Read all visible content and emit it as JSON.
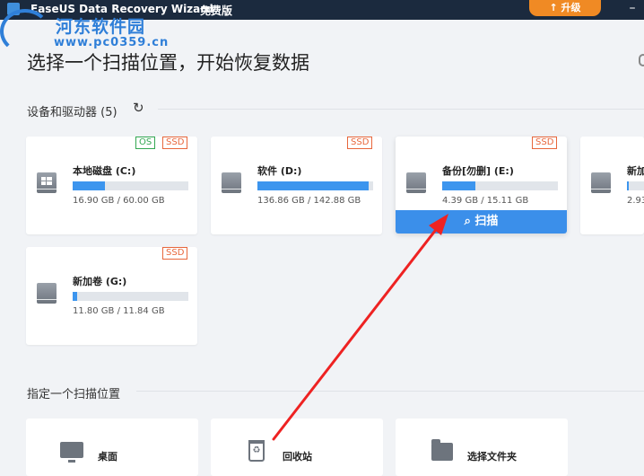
{
  "window": {
    "title": "EaseUS Data Recovery Wizard",
    "edition": "免费版",
    "upgrade_label": "升级",
    "minimize_symbol": "–"
  },
  "watermark": {
    "title": "河东软件园",
    "url": "www.pc0359.cn"
  },
  "page_title": "选择一个扫描位置，开始恢复数据",
  "devices_section": {
    "title": "设备和驱动器 (5)",
    "refresh_icon": "refresh-icon"
  },
  "drives": [
    {
      "name": "本地磁盘 (C:)",
      "used": "16.90 GB",
      "total": "60.00 GB",
      "size_text": "16.90 GB / 60.00 GB",
      "usage": 0.28,
      "badges": [
        "OS",
        "SSD"
      ],
      "icon": "windows-disk-icon"
    },
    {
      "name": "软件 (D:)",
      "used": "136.86 GB",
      "total": "142.88 GB",
      "size_text": "136.86 GB / 142.88 GB",
      "usage": 0.96,
      "badges": [
        "SSD"
      ],
      "icon": "disk-icon"
    },
    {
      "name": "备份[勿删] (E:)",
      "used": "4.39 GB",
      "total": "15.11 GB",
      "size_text": "4.39 GB / 15.11 GB",
      "usage": 0.29,
      "badges": [
        "SSD"
      ],
      "icon": "disk-icon",
      "scan_label": "扫描"
    },
    {
      "name": "新加",
      "size_text": "2.93",
      "usage": 0.1,
      "badges": [],
      "icon": "disk-icon"
    },
    {
      "name": "新加卷 (G:)",
      "used": "11.80 GB",
      "total": "11.84 GB",
      "size_text": "11.80 GB / 11.84 GB",
      "usage": 0.04,
      "badges": [
        "SSD"
      ],
      "icon": "disk-icon"
    }
  ],
  "locations_section": {
    "title": "指定一个扫描位置"
  },
  "locations": [
    {
      "label": "桌面",
      "icon": "monitor-icon"
    },
    {
      "label": "回收站",
      "icon": "recycle-bin-icon",
      "glyph": "♻"
    },
    {
      "label": "选择文件夹",
      "icon": "folder-icon"
    }
  ],
  "colors": {
    "titlebar": "#1b2a3e",
    "upgrade": "#f08a24",
    "accent": "#3b8fea",
    "ssd_badge": "#e8673c",
    "os_badge": "#33a852",
    "arrow": "#ee2222"
  }
}
